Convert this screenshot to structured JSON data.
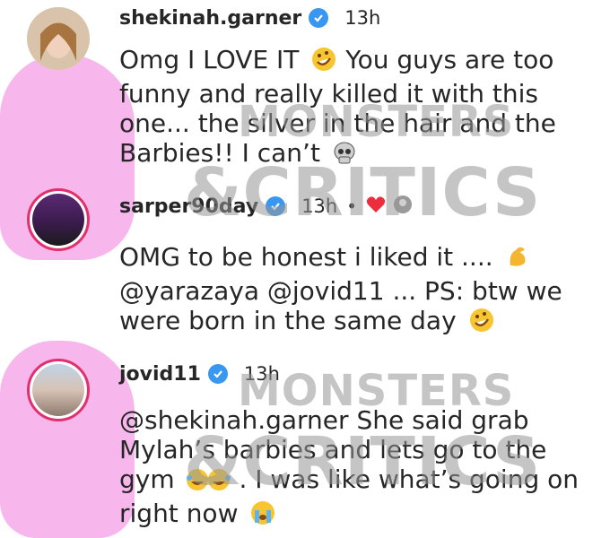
{
  "comments": [
    {
      "username": "shekinah.garner",
      "time": "13h",
      "text_before_emoji": "Omg I LOVE IT",
      "emoji_1": "rolling-on-floor-laughing",
      "text_after_emoji": "You guys are too funny and really killed it with this one... the silver in the hair and the Barbies!! I can’t",
      "emoji_2": "skull"
    },
    {
      "username": "sarper90day",
      "time": "13h",
      "meta_separator": "•",
      "text_line_1": "OMG to be honest i liked it ....",
      "emoji_1": "flexed-biceps",
      "text_line_2": "@yarazaya @jovid11 ... PS: btw we were born in the same day",
      "emoji_2": "rolling-on-floor-laughing"
    },
    {
      "username": "jovid11",
      "time": "13h",
      "text_before_emoji": "@shekinah.garner She said grab Mylah’s barbies and lets go to the gym",
      "emoji_1": "tears-of-joy",
      "text_after_emoji": ". I was like what’s going on right now",
      "emoji_2": "loudly-crying"
    }
  ],
  "watermark": {
    "line_1": "MONSTERS",
    "line_2": "&CRITICS"
  },
  "colors": {
    "verified": "#3897f0",
    "story_ring": "#e1306c",
    "watermark_pink": "#f7b6ec",
    "text": "#262626"
  }
}
